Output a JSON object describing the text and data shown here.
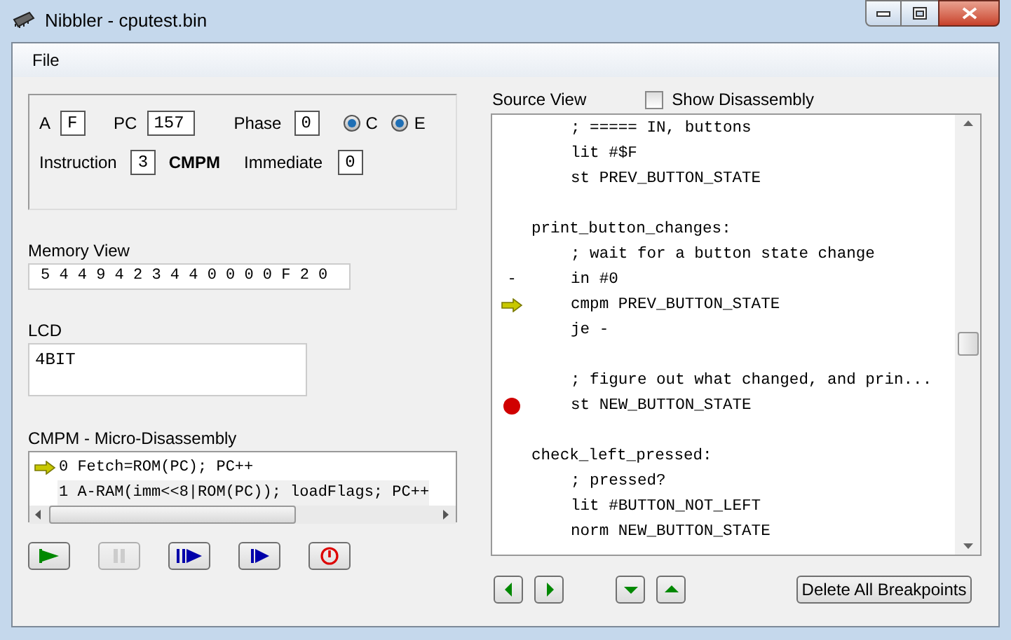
{
  "window": {
    "title": "Nibbler - cputest.bin"
  },
  "menu": [
    "File"
  ],
  "registers": {
    "a": {
      "label": "A",
      "value": "F"
    },
    "pc": {
      "label": "PC",
      "value": "157"
    },
    "phase": {
      "label": "Phase",
      "value": "0"
    },
    "flags": [
      {
        "label": "C",
        "checked": true
      },
      {
        "label": "E",
        "checked": true
      }
    ],
    "instruction": {
      "label": "Instruction",
      "value": "3",
      "mnemonic": "CMPM"
    },
    "immediate": {
      "label": "Immediate",
      "value": "0"
    }
  },
  "memory_view": {
    "label": "Memory View",
    "value": "5 4 4 9 4 2 3 4 4 0 0 0 0 F 2 0"
  },
  "lcd": {
    "label": "LCD",
    "value": "4BIT"
  },
  "micro_disassembly": {
    "label": "CMPM - Micro-Disassembly",
    "rows": [
      {
        "text": "0 Fetch=ROM(PC); PC++",
        "current": true,
        "selected": false
      },
      {
        "text": "1 A-RAM(imm<<8|ROM(PC)); loadFlags; PC++",
        "current": false,
        "selected": true
      }
    ]
  },
  "source_view": {
    "label": "Source View",
    "show_disassembly": {
      "label": "Show Disassembly",
      "checked": false
    },
    "lines": [
      {
        "kind": "code",
        "text": "; ===== IN, buttons",
        "current": false,
        "breakpoint": false
      },
      {
        "kind": "code",
        "text": "lit #$F",
        "current": false,
        "breakpoint": false
      },
      {
        "kind": "code",
        "text": "st PREV_BUTTON_STATE",
        "current": false,
        "breakpoint": false
      },
      {
        "kind": "blank",
        "current": false,
        "breakpoint": false
      },
      {
        "kind": "label",
        "text": "print_button_changes:",
        "current": false,
        "breakpoint": false
      },
      {
        "kind": "code",
        "text": "; wait for a button state change",
        "current": false,
        "breakpoint": false
      },
      {
        "kind": "code",
        "text": "in #0",
        "current": false,
        "breakpoint": false,
        "gutter": "-"
      },
      {
        "kind": "code",
        "text": "cmpm PREV_BUTTON_STATE",
        "current": true,
        "breakpoint": false
      },
      {
        "kind": "code",
        "text": "je -",
        "current": false,
        "breakpoint": false
      },
      {
        "kind": "blank",
        "current": false,
        "breakpoint": false
      },
      {
        "kind": "code",
        "text": "; figure out what changed, and prin...",
        "current": false,
        "breakpoint": false
      },
      {
        "kind": "code",
        "text": "st NEW_BUTTON_STATE",
        "current": false,
        "breakpoint": true
      },
      {
        "kind": "blank",
        "current": false,
        "breakpoint": false
      },
      {
        "kind": "label",
        "text": "check_left_pressed:",
        "current": false,
        "breakpoint": false
      },
      {
        "kind": "code",
        "text": "; pressed?",
        "current": false,
        "breakpoint": false
      },
      {
        "kind": "code",
        "text": "lit #BUTTON_NOT_LEFT",
        "current": false,
        "breakpoint": false
      },
      {
        "kind": "code",
        "text": "norm NEW_BUTTON_STATE",
        "current": false,
        "breakpoint": false
      }
    ]
  },
  "controls": [
    {
      "kind": "run",
      "disabled": false
    },
    {
      "kind": "pause",
      "disabled": true
    },
    {
      "kind": "step-cycle",
      "disabled": false
    },
    {
      "kind": "step",
      "disabled": false
    },
    {
      "kind": "reset",
      "disabled": false
    }
  ],
  "navigation": [
    {
      "kind": "left"
    },
    {
      "kind": "right"
    },
    {
      "kind": "down"
    },
    {
      "kind": "up"
    }
  ],
  "delete_breakpoints": "Delete All Breakpoints"
}
